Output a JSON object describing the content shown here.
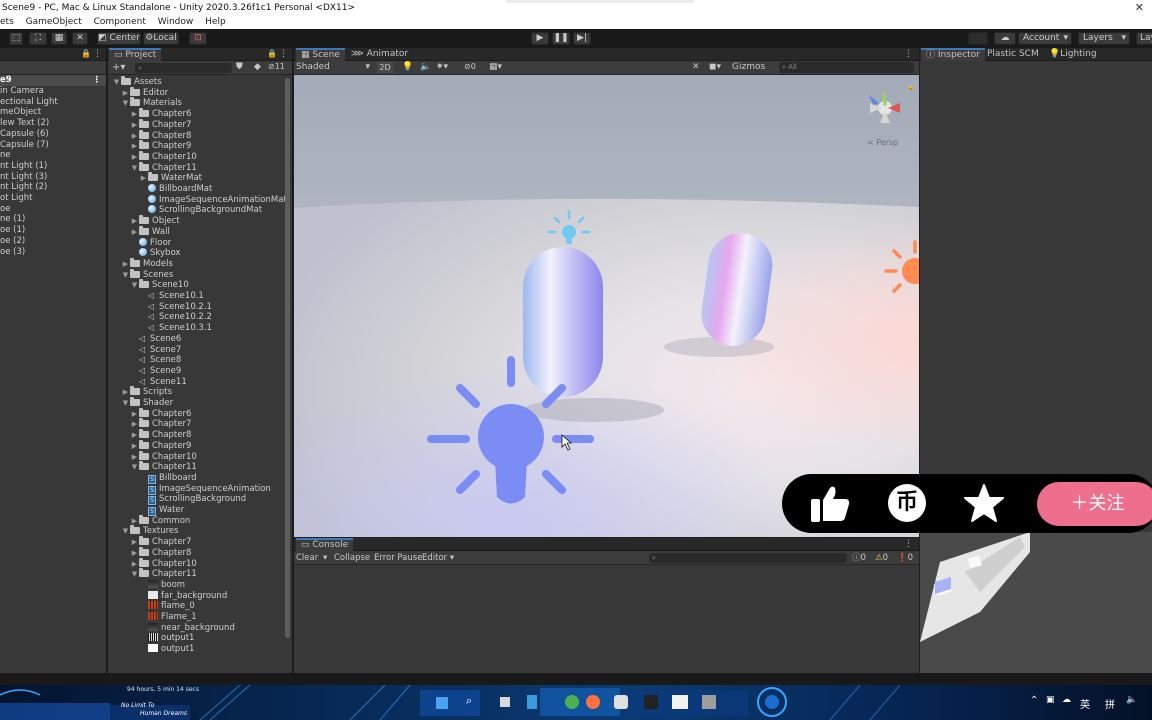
{
  "window": {
    "title": "Scene9 - PC, Mac & Linux Standalone - Unity 2020.3.26f1c1 Personal <DX11>",
    "close": "✕"
  },
  "menu": [
    "ets",
    "GameObject",
    "Component",
    "Window",
    "Help"
  ],
  "toolbar": {
    "pivot": "Center",
    "space": "Local",
    "account": "Account",
    "layers": "Layers",
    "layout": "Lay"
  },
  "hierarchy": {
    "scene": "e9",
    "items": [
      "in Camera",
      "ectional Light",
      "meObject",
      "lew Text (2)",
      "Capsule (6)",
      "Capsule (7)",
      "ne",
      "nt Light (1)",
      "nt Light (3)",
      "nt Light (2)",
      "ot Light",
      "oe",
      "ne (1)",
      "oe (1)",
      "oe (2)",
      "oe (3)"
    ]
  },
  "project": {
    "tab": "Project",
    "hidden_count": "11",
    "tree": [
      {
        "t": "Assets",
        "d": 0,
        "i": "folder",
        "o": true
      },
      {
        "t": "Editor",
        "d": 1,
        "i": "folder",
        "o": false
      },
      {
        "t": "Materials",
        "d": 1,
        "i": "folder",
        "o": true
      },
      {
        "t": "Chapter6",
        "d": 2,
        "i": "folder",
        "o": false
      },
      {
        "t": "Chapter7",
        "d": 2,
        "i": "folder",
        "o": false
      },
      {
        "t": "Chapter8",
        "d": 2,
        "i": "folder",
        "o": false
      },
      {
        "t": "Chapter9",
        "d": 2,
        "i": "folder",
        "o": false
      },
      {
        "t": "Chapter10",
        "d": 2,
        "i": "folder",
        "o": false
      },
      {
        "t": "Chapter11",
        "d": 2,
        "i": "folder",
        "o": true
      },
      {
        "t": "WaterMat",
        "d": 3,
        "i": "folder",
        "o": false
      },
      {
        "t": "BillboardMat",
        "d": 3,
        "i": "mat"
      },
      {
        "t": "ImageSequenceAnimationMat",
        "d": 3,
        "i": "mat"
      },
      {
        "t": "ScrollingBackgroundMat",
        "d": 3,
        "i": "mat"
      },
      {
        "t": "Object",
        "d": 2,
        "i": "folder",
        "o": false
      },
      {
        "t": "Wall",
        "d": 2,
        "i": "folder",
        "o": false
      },
      {
        "t": "Floor",
        "d": 2,
        "i": "mat"
      },
      {
        "t": "Skybox",
        "d": 2,
        "i": "mat"
      },
      {
        "t": "Models",
        "d": 1,
        "i": "folder",
        "o": false
      },
      {
        "t": "Scenes",
        "d": 1,
        "i": "folder",
        "o": true
      },
      {
        "t": "Scene10",
        "d": 2,
        "i": "folder",
        "o": true
      },
      {
        "t": "Scene10.1",
        "d": 3,
        "i": "scene"
      },
      {
        "t": "Scene10.2.1",
        "d": 3,
        "i": "scene"
      },
      {
        "t": "Scene10.2.2",
        "d": 3,
        "i": "scene"
      },
      {
        "t": "Scene10.3.1",
        "d": 3,
        "i": "scene"
      },
      {
        "t": "Scene6",
        "d": 2,
        "i": "scene"
      },
      {
        "t": "Scene7",
        "d": 2,
        "i": "scene"
      },
      {
        "t": "Scene8",
        "d": 2,
        "i": "scene"
      },
      {
        "t": "Scene9",
        "d": 2,
        "i": "scene"
      },
      {
        "t": "Scene11",
        "d": 2,
        "i": "scene"
      },
      {
        "t": "Scripts",
        "d": 1,
        "i": "folder",
        "o": false
      },
      {
        "t": "Shader",
        "d": 1,
        "i": "folder",
        "o": true
      },
      {
        "t": "Chapter6",
        "d": 2,
        "i": "folder",
        "o": false
      },
      {
        "t": "Chapter7",
        "d": 2,
        "i": "folder",
        "o": false
      },
      {
        "t": "Chapter8",
        "d": 2,
        "i": "folder",
        "o": false
      },
      {
        "t": "Chapter9",
        "d": 2,
        "i": "folder",
        "o": false
      },
      {
        "t": "Chapter10",
        "d": 2,
        "i": "folder",
        "o": false
      },
      {
        "t": "Chapter11",
        "d": 2,
        "i": "folder",
        "o": true
      },
      {
        "t": "Billboard",
        "d": 3,
        "i": "shader"
      },
      {
        "t": "ImageSequenceAnimation",
        "d": 3,
        "i": "shader"
      },
      {
        "t": "ScrollingBackground",
        "d": 3,
        "i": "shader"
      },
      {
        "t": "Water",
        "d": 3,
        "i": "shader"
      },
      {
        "t": "Common",
        "d": 2,
        "i": "folder",
        "o": false
      },
      {
        "t": "Textures",
        "d": 1,
        "i": "folder",
        "o": true
      },
      {
        "t": "Chapter7",
        "d": 2,
        "i": "folder",
        "o": false
      },
      {
        "t": "Chapter8",
        "d": 2,
        "i": "folder",
        "o": false
      },
      {
        "t": "Chapter10",
        "d": 2,
        "i": "folder",
        "o": false
      },
      {
        "t": "Chapter11",
        "d": 2,
        "i": "folder",
        "o": true
      },
      {
        "t": "boom",
        "d": 3,
        "i": "tex-dark"
      },
      {
        "t": "far_background",
        "d": 3,
        "i": "tex-light"
      },
      {
        "t": "flame_0",
        "d": 3,
        "i": "tex-fire"
      },
      {
        "t": "Flame_1",
        "d": 3,
        "i": "tex-fire"
      },
      {
        "t": "near_background",
        "d": 3,
        "i": "tex-dark"
      },
      {
        "t": "output1",
        "d": 3,
        "i": "tex-grid"
      },
      {
        "t": "output1",
        "d": 3,
        "i": "tex-white"
      }
    ]
  },
  "scene": {
    "tabs": [
      "Scene",
      "Animator"
    ],
    "shading": "Shaded",
    "mode_2d": "2D",
    "hidden_count": "0",
    "gizmos": "Gizmos",
    "search_placeholder": "All",
    "persp": "< Persp"
  },
  "console": {
    "tab": "Console",
    "clear": "Clear",
    "collapse": "Collapse",
    "error_pause": "Error Pause",
    "editor": "Editor",
    "counts": [
      "0",
      "0",
      "0"
    ]
  },
  "inspector": {
    "tabs": [
      "Inspector",
      "Plastic SCM",
      "Lighting"
    ]
  },
  "overlay": {
    "follow": "＋关注",
    "coin": "币"
  },
  "taskbar": {
    "hud_time": "94 hours, 5 min 14 secs",
    "hud_brand1": "No Limit To",
    "hud_brand2": "Human Dreams",
    "ime": "英",
    "layout": "拼"
  },
  "colors": {
    "unity_accent": "#3a79bb",
    "light_icon_blue": "#7b8cf5",
    "light_icon_orange": "#ff8a52",
    "follow_pink": "#ee6e8d"
  }
}
